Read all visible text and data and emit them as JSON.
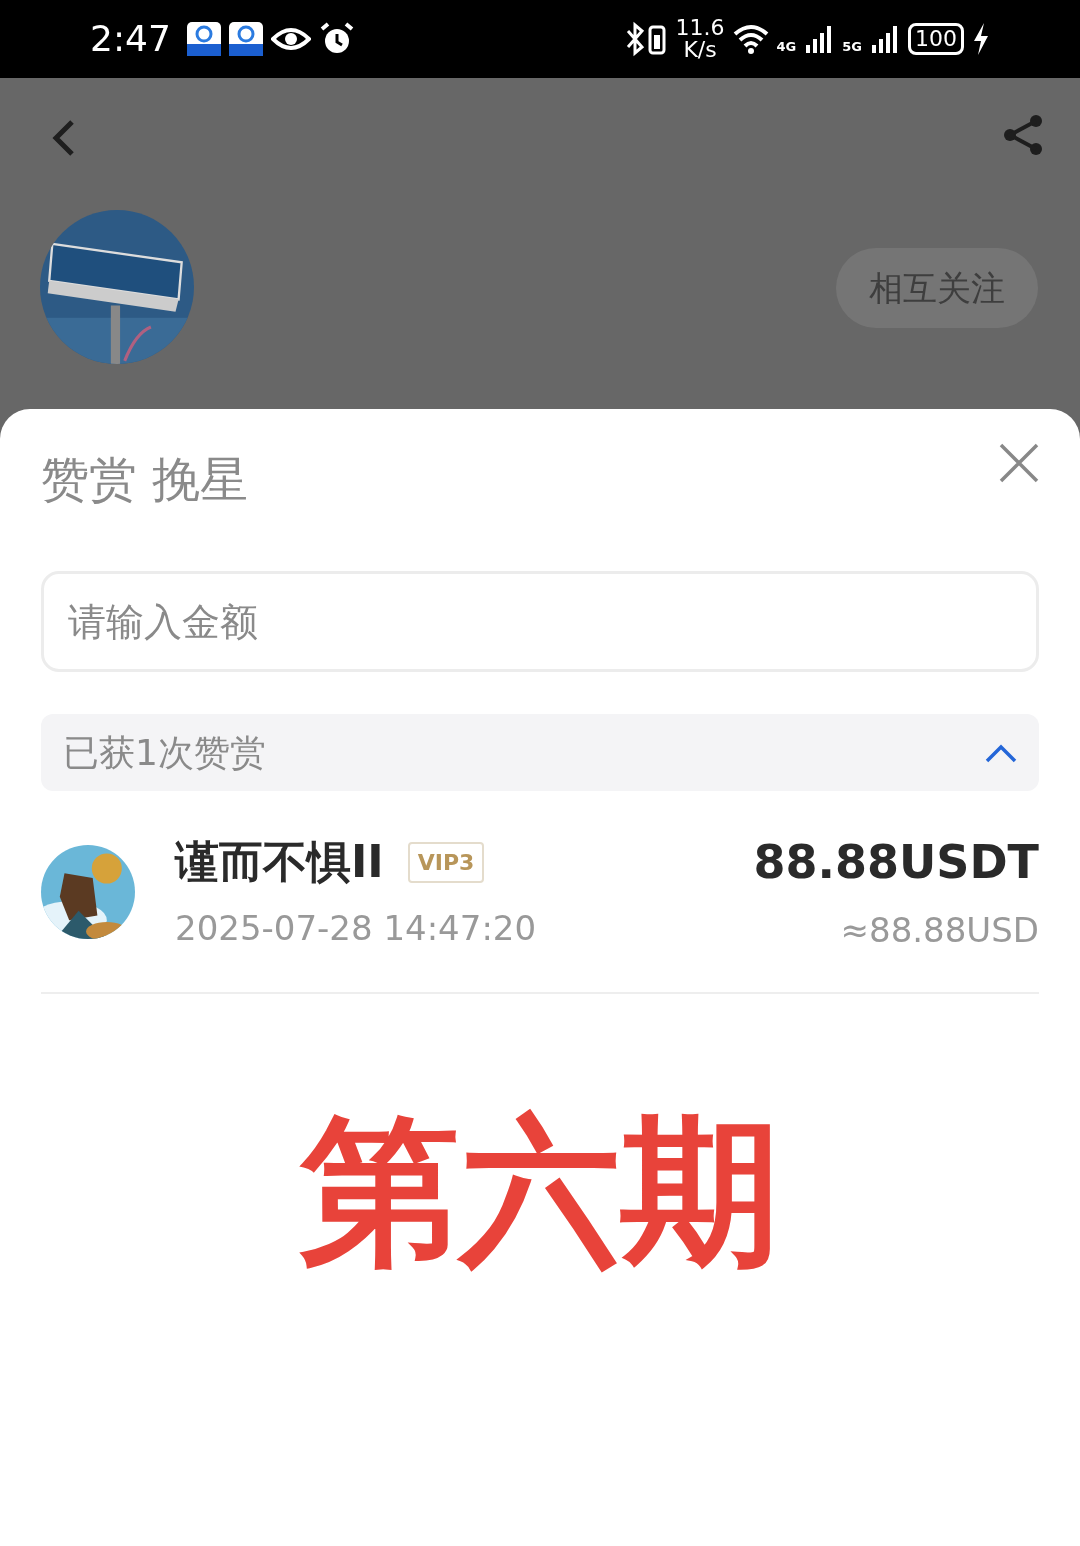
{
  "status_bar": {
    "time": "2:47",
    "speed_value": "11.6",
    "speed_unit": "K/s",
    "network_1": "4G",
    "network_2": "5G",
    "battery": "100"
  },
  "profile": {
    "follow_button": "相互关注"
  },
  "sheet": {
    "title": "赞赏 挽星",
    "amount_field": {
      "placeholder": "请输入金额"
    },
    "summary": {
      "label": "已获1次赞赏",
      "expanded": true
    },
    "rewards": [
      {
        "name": "谨而不惧II",
        "badge": "VIP3",
        "time": "2025-07-28 14:47:20",
        "amount": "88.88USDT",
        "approx": "≈88.88USD"
      }
    ]
  },
  "caption": "第六期"
}
